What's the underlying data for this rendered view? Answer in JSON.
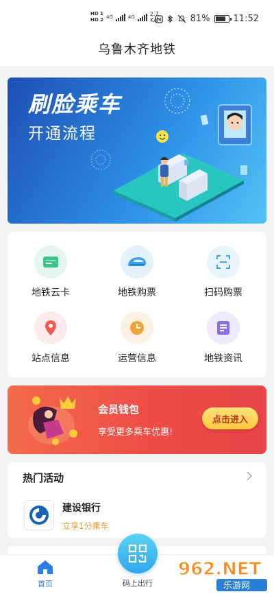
{
  "status_bar": {
    "sim1": "HD 1",
    "sim2": "HD 2",
    "net1": "4G",
    "net2": "4G",
    "speed_value": "2.7",
    "speed_unit": "K/s",
    "nfc_icon": "nfc-icon",
    "bluetooth_icon": "bluetooth-icon",
    "mute_icon": "mute-icon",
    "battery": "81%",
    "battery_level": 0.81,
    "time": "11:52"
  },
  "header": {
    "title": "乌鲁木齐地铁"
  },
  "banner": {
    "title": "刷脸乘车",
    "subtitle": "开通流程"
  },
  "grid": [
    {
      "label": "地铁云卡",
      "icon": "card-icon",
      "bg": "#e3f7ee",
      "color": "#3dc489"
    },
    {
      "label": "地铁购票",
      "icon": "train-ticket-icon",
      "bg": "#e3f1fb",
      "color": "#3aa0e8"
    },
    {
      "label": "扫码购票",
      "icon": "scan-icon",
      "bg": "#e8f4fb",
      "color": "#3fa6e6"
    },
    {
      "label": "站点信息",
      "icon": "location-pin-icon",
      "bg": "#fdeaea",
      "color": "#ef5a55"
    },
    {
      "label": "运营信息",
      "icon": "clock-icon",
      "bg": "#fdf1e3",
      "color": "#f0a33a"
    },
    {
      "label": "地铁资讯",
      "icon": "news-icon",
      "bg": "#efeafb",
      "color": "#8c6fe3"
    }
  ],
  "wallet": {
    "title": "会员钱包",
    "subtitle": "享受更多乘车优惠!",
    "button": "点击进入"
  },
  "activities": {
    "title": "热门活动",
    "items": [
      {
        "name": "建设银行",
        "desc": "立享1分乘车",
        "logo": "ccb-logo-icon"
      }
    ]
  },
  "tabbar": {
    "home": "首页",
    "scan": "码上出行"
  },
  "watermark": {
    "text": "962.NET",
    "sub": "乐游网"
  },
  "colors": {
    "accent": "#2f7be8",
    "wallet": "#ee4a47",
    "gold": "#e09a2c"
  }
}
